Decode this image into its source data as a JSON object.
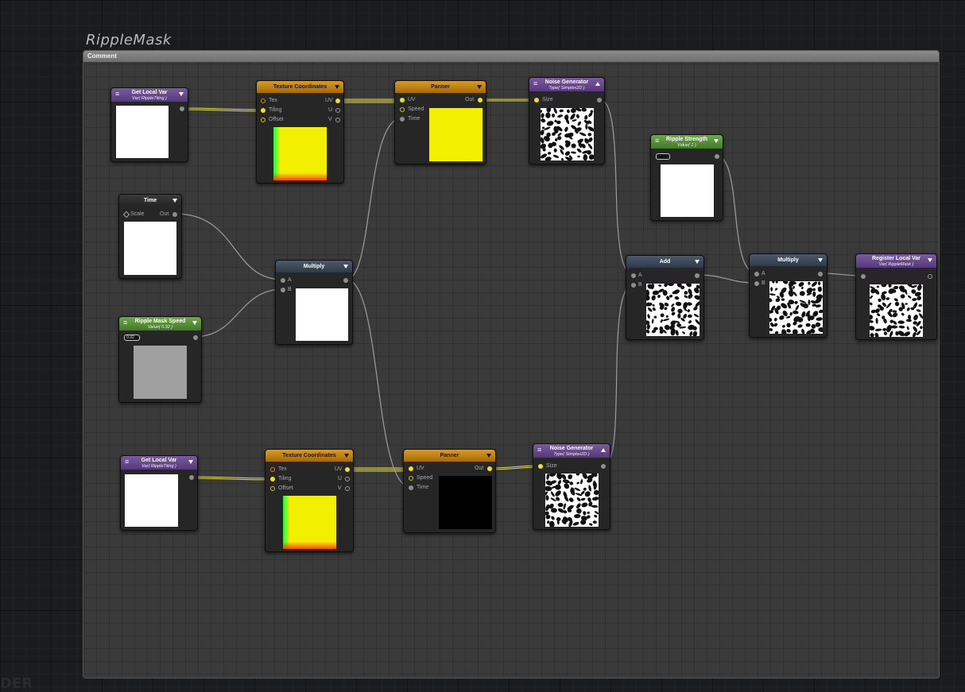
{
  "canvas": {
    "comment_title": "RippleMask",
    "comment_label": "Comment",
    "watermark": "DER"
  },
  "nodes": {
    "get_local_var_1": {
      "title": "Get Local Var",
      "subtitle": "Var( RippleTiling )"
    },
    "texcoord_1": {
      "title": "Texture Coordinates",
      "in_tex": "Tex",
      "in_tiling": "Tiling",
      "in_offset": "Offset",
      "out_uv": "UV",
      "out_u": "U",
      "out_v": "V"
    },
    "panner_1": {
      "title": "Panner",
      "in_uv": "UV",
      "in_speed": "Speed",
      "in_time": "Time",
      "out": "Out"
    },
    "noise_1": {
      "title": "Noise Generator",
      "subtitle": "Type( Simplex2D )",
      "in_size": "Size"
    },
    "time": {
      "title": "Time",
      "in_scale": "Scale",
      "out": "Out"
    },
    "ripple_mask_speed": {
      "title": "Ripple Mask Speed",
      "subtitle": "Value( 0.32 )",
      "value": "0.32"
    },
    "multiply_1": {
      "title": "Multiply",
      "in_a": "A",
      "in_b": "B"
    },
    "ripple_strength": {
      "title": "Ripple Strength",
      "subtitle": "Value( 1 )",
      "value": ""
    },
    "add": {
      "title": "Add",
      "in_a": "A",
      "in_b": "B"
    },
    "multiply_2": {
      "title": "Multiply",
      "in_a": "A",
      "in_b": "B"
    },
    "register_local_var": {
      "title": "Register Local Var",
      "subtitle": "Var( RippleMask )"
    },
    "get_local_var_2": {
      "title": "Get Local Var",
      "subtitle": "Var( RippleTiling )"
    },
    "texcoord_2": {
      "title": "Texture Coordinates",
      "in_tex": "Tex",
      "in_tiling": "Tiling",
      "in_offset": "Offset",
      "out_uv": "UV",
      "out_u": "U",
      "out_v": "V"
    },
    "panner_2": {
      "title": "Panner",
      "in_uv": "UV",
      "in_speed": "Speed",
      "in_time": "Time",
      "out": "Out"
    },
    "noise_2": {
      "title": "Noise Generator",
      "subtitle": "Type( Simplex2D )",
      "in_size": "Size"
    }
  },
  "colors": {
    "header_orange": "#c0820f",
    "header_purple": "#6a4a90",
    "header_green": "#5a9138",
    "header_steel": "#3d4858",
    "wire_yellow": "#e2e04a",
    "wire_gray": "#9c9c9c"
  },
  "icons": {
    "node_menu": "hamburger-icon",
    "node_collapse": "triangle-down-icon",
    "node_expand": "triangle-up-icon"
  }
}
